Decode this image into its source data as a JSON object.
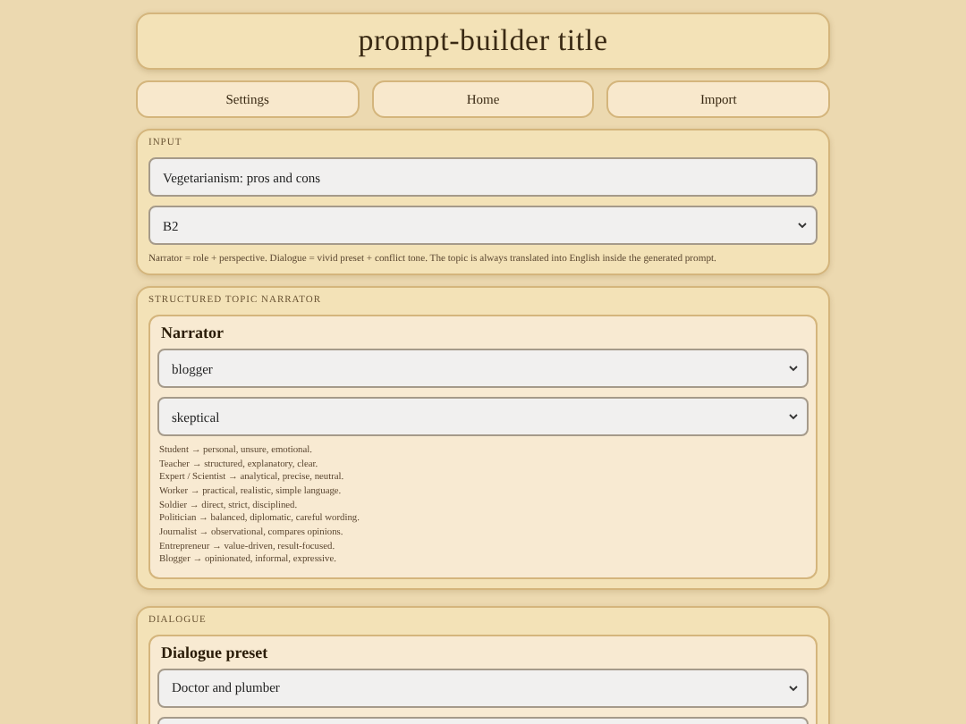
{
  "title": "prompt-builder title",
  "nav_buttons": [
    "Settings",
    "Home",
    "Import"
  ],
  "input_section": {
    "label": "INPUT",
    "topic_field": {
      "value": "Vegetarianism: pros and cons"
    },
    "level_select": {
      "value": "B2"
    },
    "hint": "Narrator = role + perspective. Dialogue = vivid preset + conflict tone. The topic is always translated into English inside the generated prompt."
  },
  "narrator_section": {
    "label": "STRUCTURED TOPIC NARRATOR",
    "card": {
      "heading": "Narrator",
      "role_select": {
        "value": "blogger"
      },
      "perspective_select": {
        "value": "skeptical"
      },
      "role_notes": [
        "Student → personal, unsure, emotional.",
        "Teacher → structured, explanatory, clear.",
        "Expert / Scientist → analytical, precise, neutral.",
        "Worker → practical, realistic, simple language.",
        "Soldier → direct, strict, disciplined.",
        "Politician → balanced, diplomatic, careful wording.",
        "Journalist → observational, compares opinions.",
        "Entrepreneur → value-driven, result-focused.",
        "Blogger → opinionated, informal, expressive."
      ]
    }
  },
  "dialogue_section": {
    "label": "DIALOGUE",
    "card": {
      "heading": "Dialogue preset",
      "preset_select": {
        "value": "Doctor and plumber"
      }
    }
  }
}
